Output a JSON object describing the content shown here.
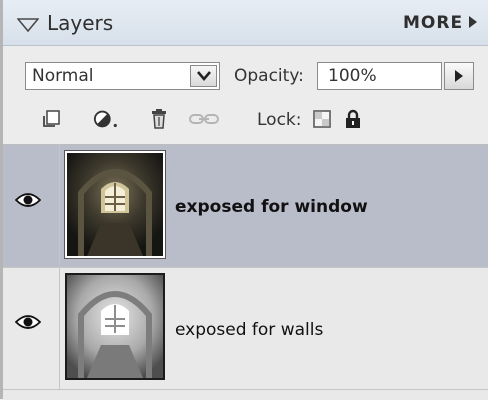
{
  "panel": {
    "title": "Layers",
    "more_label": "MORE"
  },
  "controls": {
    "blend_mode": "Normal",
    "opacity_label": "Opacity:",
    "opacity_value": "100%",
    "lock_label": "Lock:"
  },
  "tools": [
    {
      "icon": "new-layer-icon"
    },
    {
      "icon": "adjustment-layer-icon"
    },
    {
      "icon": "trash-icon"
    },
    {
      "icon": "link-icon"
    }
  ],
  "layers": [
    {
      "name": "exposed for window",
      "selected": true,
      "visible": true
    },
    {
      "name": "exposed for walls",
      "selected": false,
      "visible": true
    }
  ],
  "colors": {
    "header_bg": "#dfe6ee",
    "selected_row": "#b9bcc9",
    "panel_bg": "#eeeeee"
  }
}
